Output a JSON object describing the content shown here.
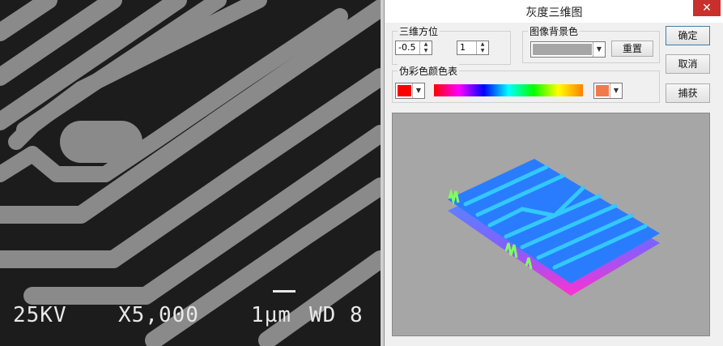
{
  "sem_overlay": {
    "voltage": "25KV",
    "magnification": "X5,000",
    "scale": "1µm",
    "wd": "WD 8"
  },
  "dialog": {
    "title": "灰度三维图",
    "close_glyph": "✕",
    "orientation": {
      "label": "三维方位",
      "value_a": "-0.5",
      "value_b": "1"
    },
    "background": {
      "label": "图像背景色",
      "color": "#a6a6a6",
      "reset_label": "重置"
    },
    "pseudo": {
      "label": "伪彩色颜色表",
      "start_color": "#ff0000",
      "end_color": "#f07a4a"
    },
    "buttons": {
      "ok": "确定",
      "cancel": "取消",
      "capture": "捕获"
    }
  },
  "icons": {
    "spin": "up-down-arrows",
    "dropdown": "chevron-down-icon",
    "close": "close-icon"
  }
}
